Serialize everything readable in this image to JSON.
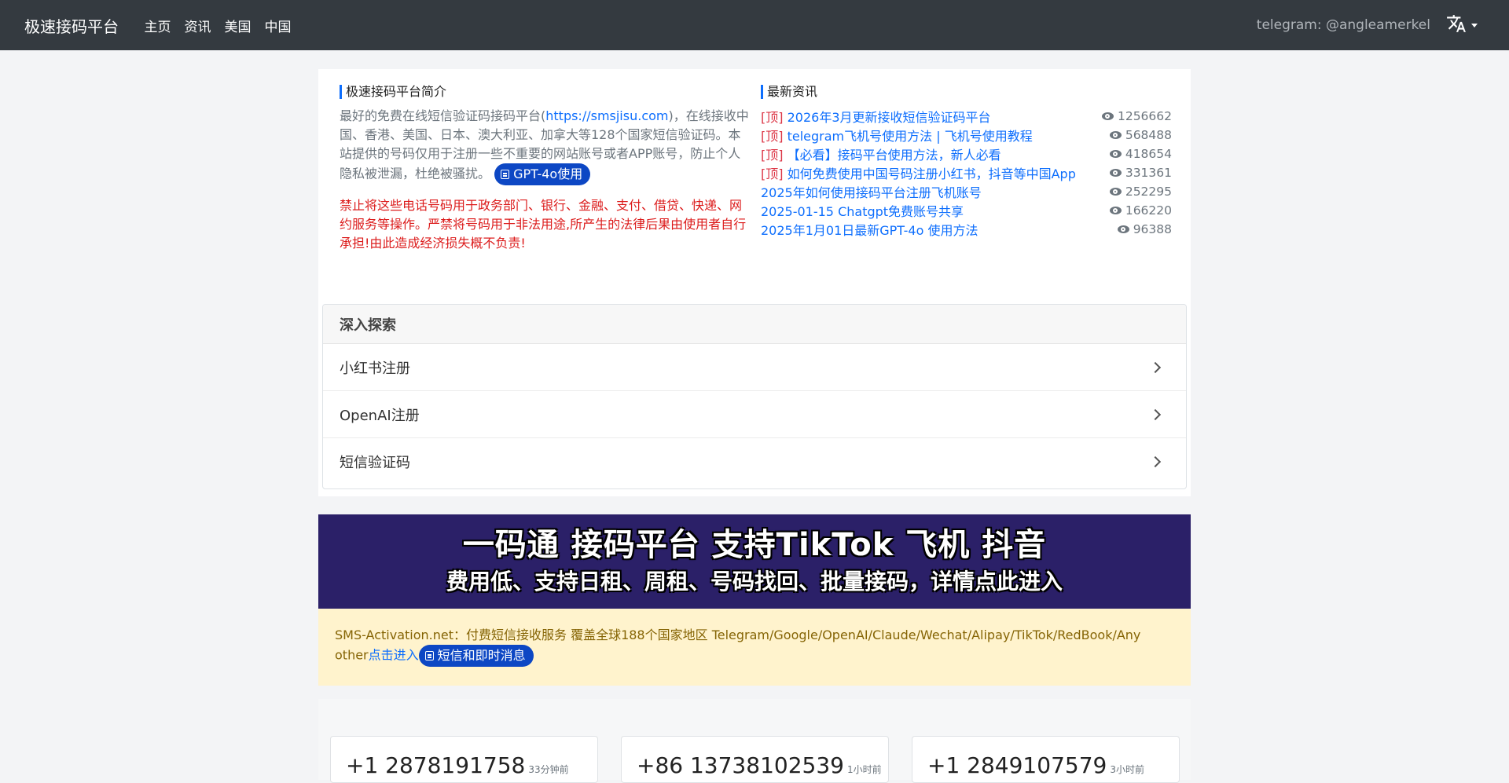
{
  "nav": {
    "brand": "极速接码平台",
    "links": [
      "主页",
      "资讯",
      "美国",
      "中国"
    ],
    "telegram": "telegram: @angleamerkel"
  },
  "intro": {
    "title": "极速接码平台简介",
    "text_before": "最好的免费在线短信验证码接码平台(",
    "link": "https://smsjisu.com",
    "text_after": ")，在线接收中国、香港、美国、日本、澳大利亚、加拿大等128个国家短信验证码。本站提供的号码仅用于注册一些不重要的网站账号或者APP账号，防止个人隐私被泄漏，杜绝被骚扰。",
    "gpt_button": "GPT-4o使用",
    "warning": "禁止将这些电话号码用于政务部门、银行、金融、支付、借贷、快递、网约服务等操作。严禁将号码用于非法用途,所产生的法律后果由使用者自行承担!由此造成经济损失概不负责!"
  },
  "news": {
    "title": "最新资讯",
    "items": [
      {
        "tag": "[顶]",
        "title": "2026年3月更新接收短信验证码平台",
        "views": "1256662"
      },
      {
        "tag": "[顶]",
        "title": "telegram飞机号使用方法 | 飞机号使用教程",
        "views": "568488"
      },
      {
        "tag": "[顶]",
        "title": "【必看】接码平台使用方法，新人必看",
        "views": "418654"
      },
      {
        "tag": "[顶]",
        "title": "如何免费使用中国号码注册小红书，抖音等中国App",
        "views": "331361"
      },
      {
        "tag": "",
        "title": "2025年如何使用接码平台注册飞机账号",
        "views": "252295"
      },
      {
        "tag": "",
        "title": "2025-01-15 Chatgpt免费账号共享",
        "views": "166220"
      },
      {
        "tag": "",
        "title": "2025年1月01日最新GPT-4o 使用方法",
        "views": "96388"
      }
    ]
  },
  "explore": {
    "title": "深入探索",
    "items": [
      "小红书注册",
      "OpenAI注册",
      "短信验证码"
    ]
  },
  "banner": {
    "line1": "一码通 接码平台  支持TikTok 飞机 抖音",
    "line2": "费用低、支持日租、周租、号码找回、批量接码，详情点此进入"
  },
  "alert": {
    "text": "SMS-Activation.net：付费短信接收服务 覆盖全球188个国家地区 Telegram/Google/OpenAI/Claude/Wechat/Alipay/TikTok/RedBook/Any other",
    "link": "点击进入",
    "button": "短信和即时消息"
  },
  "numbers": [
    {
      "phone": "+1 2878191758",
      "ago": "33分钟前"
    },
    {
      "phone": "+86 13738102539",
      "ago": "1小时前"
    },
    {
      "phone": "+1 2849107579",
      "ago": "3小时前"
    }
  ]
}
